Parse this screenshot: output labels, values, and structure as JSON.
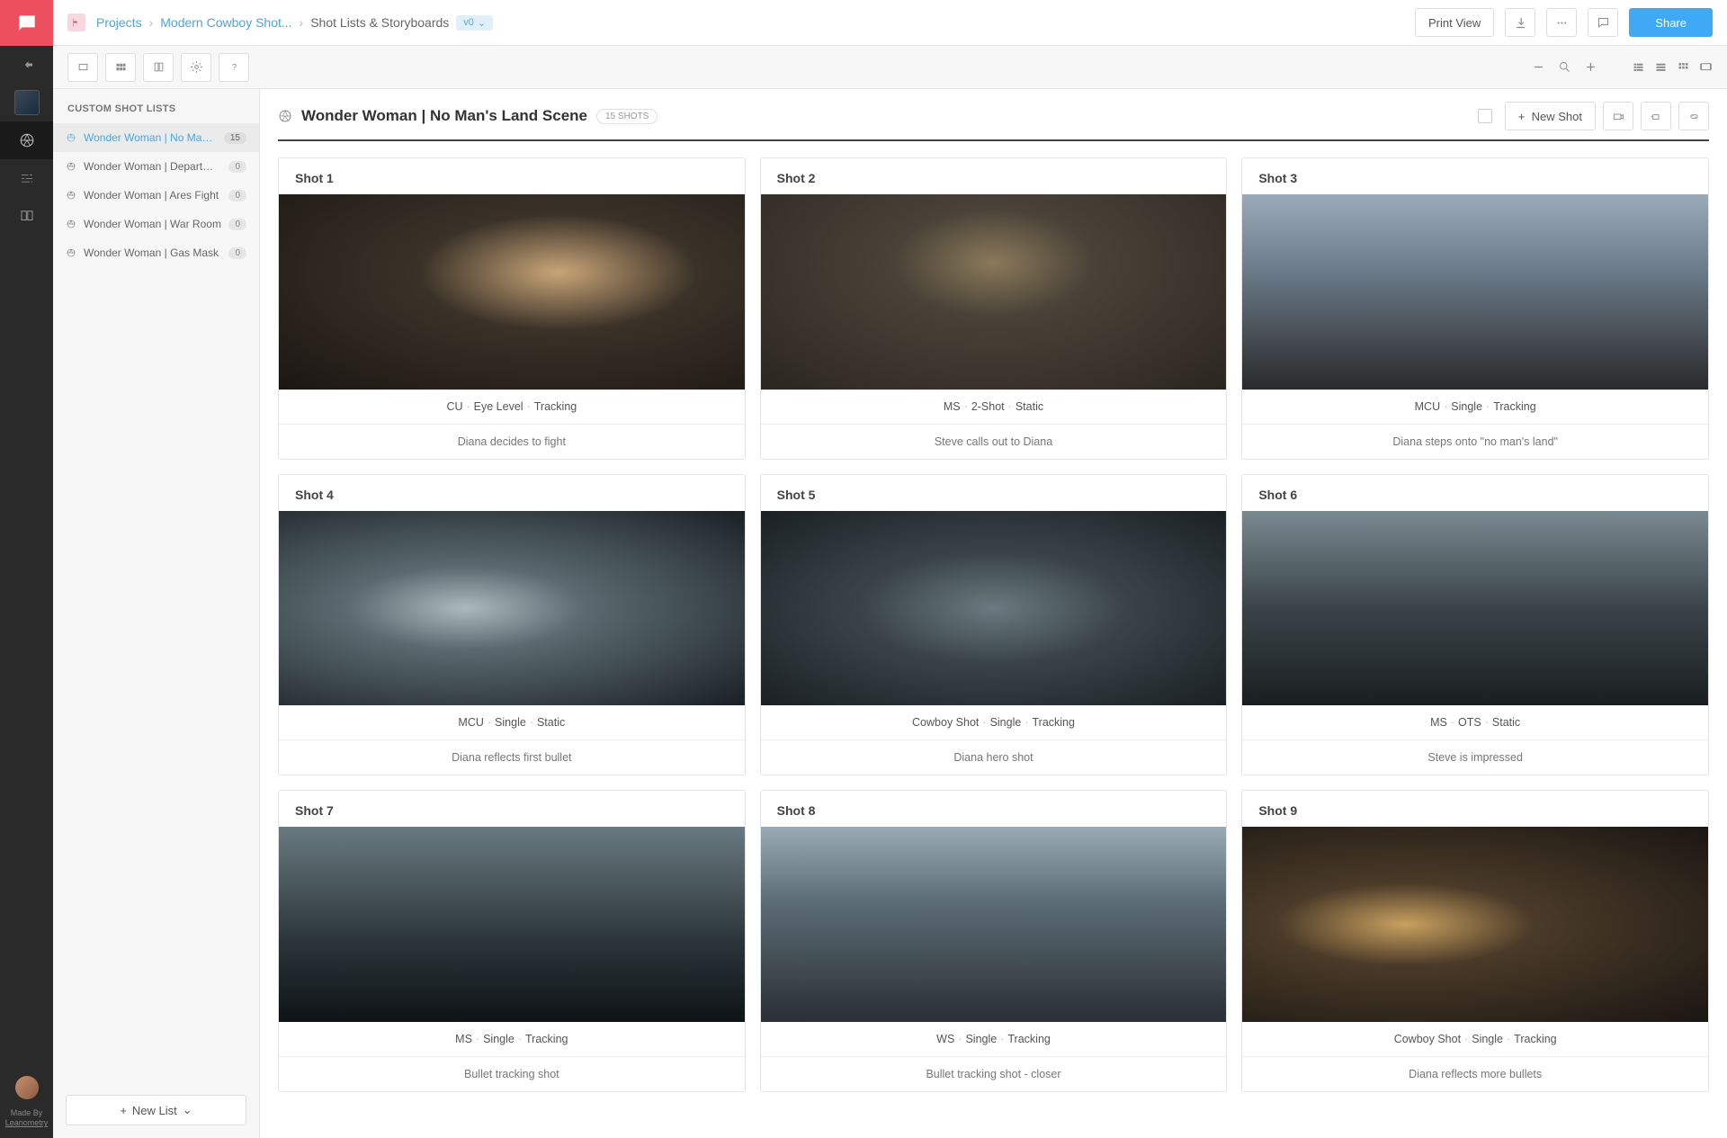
{
  "breadcrumb": {
    "projects": "Projects",
    "project": "Modern Cowboy Shot...",
    "page": "Shot Lists & Storyboards",
    "version": "v0"
  },
  "topbar": {
    "printView": "Print View",
    "share": "Share"
  },
  "sidebar": {
    "heading": "CUSTOM SHOT LISTS",
    "newList": "New List",
    "items": [
      {
        "label": "Wonder Woman | No Man's Land ...",
        "count": "15",
        "active": true
      },
      {
        "label": "Wonder Woman | Department Store",
        "count": "0",
        "active": false
      },
      {
        "label": "Wonder Woman | Ares Fight",
        "count": "0",
        "active": false
      },
      {
        "label": "Wonder Woman | War Room",
        "count": "0",
        "active": false
      },
      {
        "label": "Wonder Woman | Gas Mask",
        "count": "0",
        "active": false
      }
    ]
  },
  "content": {
    "title": "Wonder Woman | No Man's Land Scene",
    "shotsBadge": "15 SHOTS",
    "newShot": "New Shot"
  },
  "shots": [
    {
      "title": "Shot 1",
      "meta": [
        "CU",
        "Eye Level",
        "Tracking"
      ],
      "desc": "Diana decides to fight",
      "still": "still-1"
    },
    {
      "title": "Shot 2",
      "meta": [
        "MS",
        "2-Shot",
        "Static"
      ],
      "desc": "Steve calls out to Diana",
      "still": "still-2"
    },
    {
      "title": "Shot 3",
      "meta": [
        "MCU",
        "Single",
        "Tracking"
      ],
      "desc": "Diana steps onto \"no man's land\"",
      "still": "still-3"
    },
    {
      "title": "Shot 4",
      "meta": [
        "MCU",
        "Single",
        "Static"
      ],
      "desc": "Diana reflects first bullet",
      "still": "still-4"
    },
    {
      "title": "Shot 5",
      "meta": [
        "Cowboy Shot",
        "Single",
        "Tracking"
      ],
      "desc": "Diana hero shot",
      "still": "still-5"
    },
    {
      "title": "Shot 6",
      "meta": [
        "MS",
        "OTS",
        "Static"
      ],
      "desc": "Steve is impressed",
      "still": "still-6"
    },
    {
      "title": "Shot 7",
      "meta": [
        "MS",
        "Single",
        "Tracking"
      ],
      "desc": "Bullet tracking shot",
      "still": "still-7"
    },
    {
      "title": "Shot 8",
      "meta": [
        "WS",
        "Single",
        "Tracking"
      ],
      "desc": "Bullet tracking shot - closer",
      "still": "still-8"
    },
    {
      "title": "Shot 9",
      "meta": [
        "Cowboy Shot",
        "Single",
        "Tracking"
      ],
      "desc": "Diana reflects more bullets",
      "still": "still-9"
    }
  ],
  "railCredit": {
    "madeBy": "Made By",
    "name": "Leanometry"
  }
}
